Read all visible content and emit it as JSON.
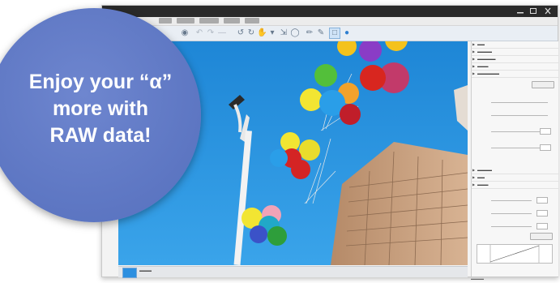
{
  "promo": {
    "line1": "Enjoy your “α”",
    "line2": "more with",
    "line3": "RAW data!"
  },
  "window": {
    "menu_count": 6
  },
  "colors": {
    "circle": "#5f78c4",
    "sky": "#2a95e0"
  }
}
